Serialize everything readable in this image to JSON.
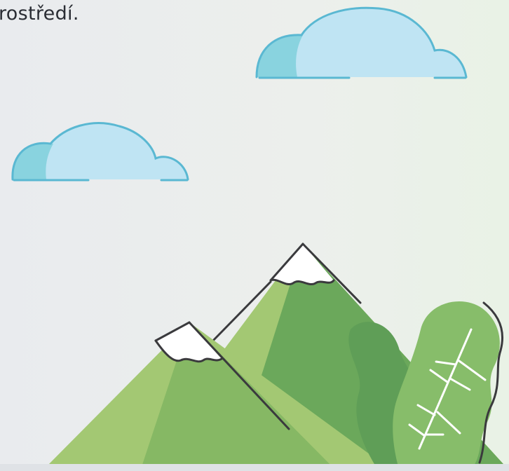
{
  "text": {
    "fragment": "rostředí."
  },
  "icons": {
    "cloud_large": "cloud-icon",
    "cloud_small": "cloud-icon",
    "mountains": "mountain-icon",
    "leaves": "leaf-icon"
  },
  "colors": {
    "cloud_fill": "#bfe4f3",
    "cloud_shadow": "#89d3df",
    "cloud_outline": "#5ab8d2",
    "mountain_light": "#a3c873",
    "mountain_dark": "#6ba85b",
    "snow": "#ffffff",
    "outline": "#3a3a3d",
    "leaf_dark": "#5f9e57",
    "leaf_light": "#87bd6a"
  }
}
